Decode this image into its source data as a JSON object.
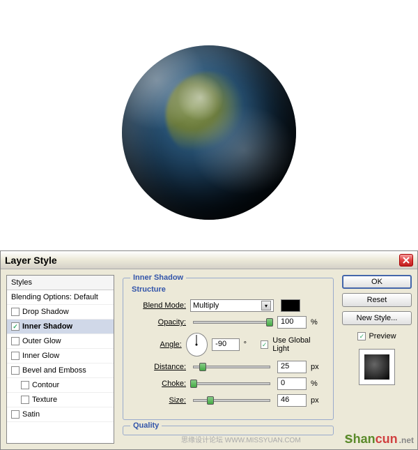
{
  "dialog": {
    "title": "Layer Style",
    "close": "X"
  },
  "styles": {
    "header": "Styles",
    "blending": "Blending Options: Default",
    "items": [
      {
        "label": "Drop Shadow",
        "checked": false
      },
      {
        "label": "Inner Shadow",
        "checked": true,
        "selected": true
      },
      {
        "label": "Outer Glow",
        "checked": false
      },
      {
        "label": "Inner Glow",
        "checked": false
      },
      {
        "label": "Bevel and Emboss",
        "checked": false
      },
      {
        "label": "Contour",
        "checked": false,
        "sub": true
      },
      {
        "label": "Texture",
        "checked": false,
        "sub": true
      },
      {
        "label": "Satin",
        "checked": false
      }
    ]
  },
  "settings": {
    "section_title": "Inner Shadow",
    "structure_label": "Structure",
    "blend_mode": {
      "label": "Blend Mode:",
      "value": "Multiply"
    },
    "opacity": {
      "label": "Opacity:",
      "value": "100",
      "unit": "%",
      "pos": 100
    },
    "angle": {
      "label": "Angle:",
      "value": "-90",
      "unit": "°",
      "global": "Use Global Light",
      "global_checked": true
    },
    "distance": {
      "label": "Distance:",
      "value": "25",
      "unit": "px",
      "pos": 12
    },
    "choke": {
      "label": "Choke:",
      "value": "0",
      "unit": "%",
      "pos": 0
    },
    "size": {
      "label": "Size:",
      "value": "46",
      "unit": "px",
      "pos": 22
    },
    "quality_label": "Quality"
  },
  "buttons": {
    "ok": "OK",
    "reset": "Reset",
    "new_style": "New Style...",
    "preview": "Preview",
    "preview_checked": true
  },
  "footer": "思缘设计论坛  WWW.MISSYUAN.COM",
  "watermark": {
    "s": "s",
    "han": "han",
    "cun": "cun",
    "net": ".net"
  }
}
